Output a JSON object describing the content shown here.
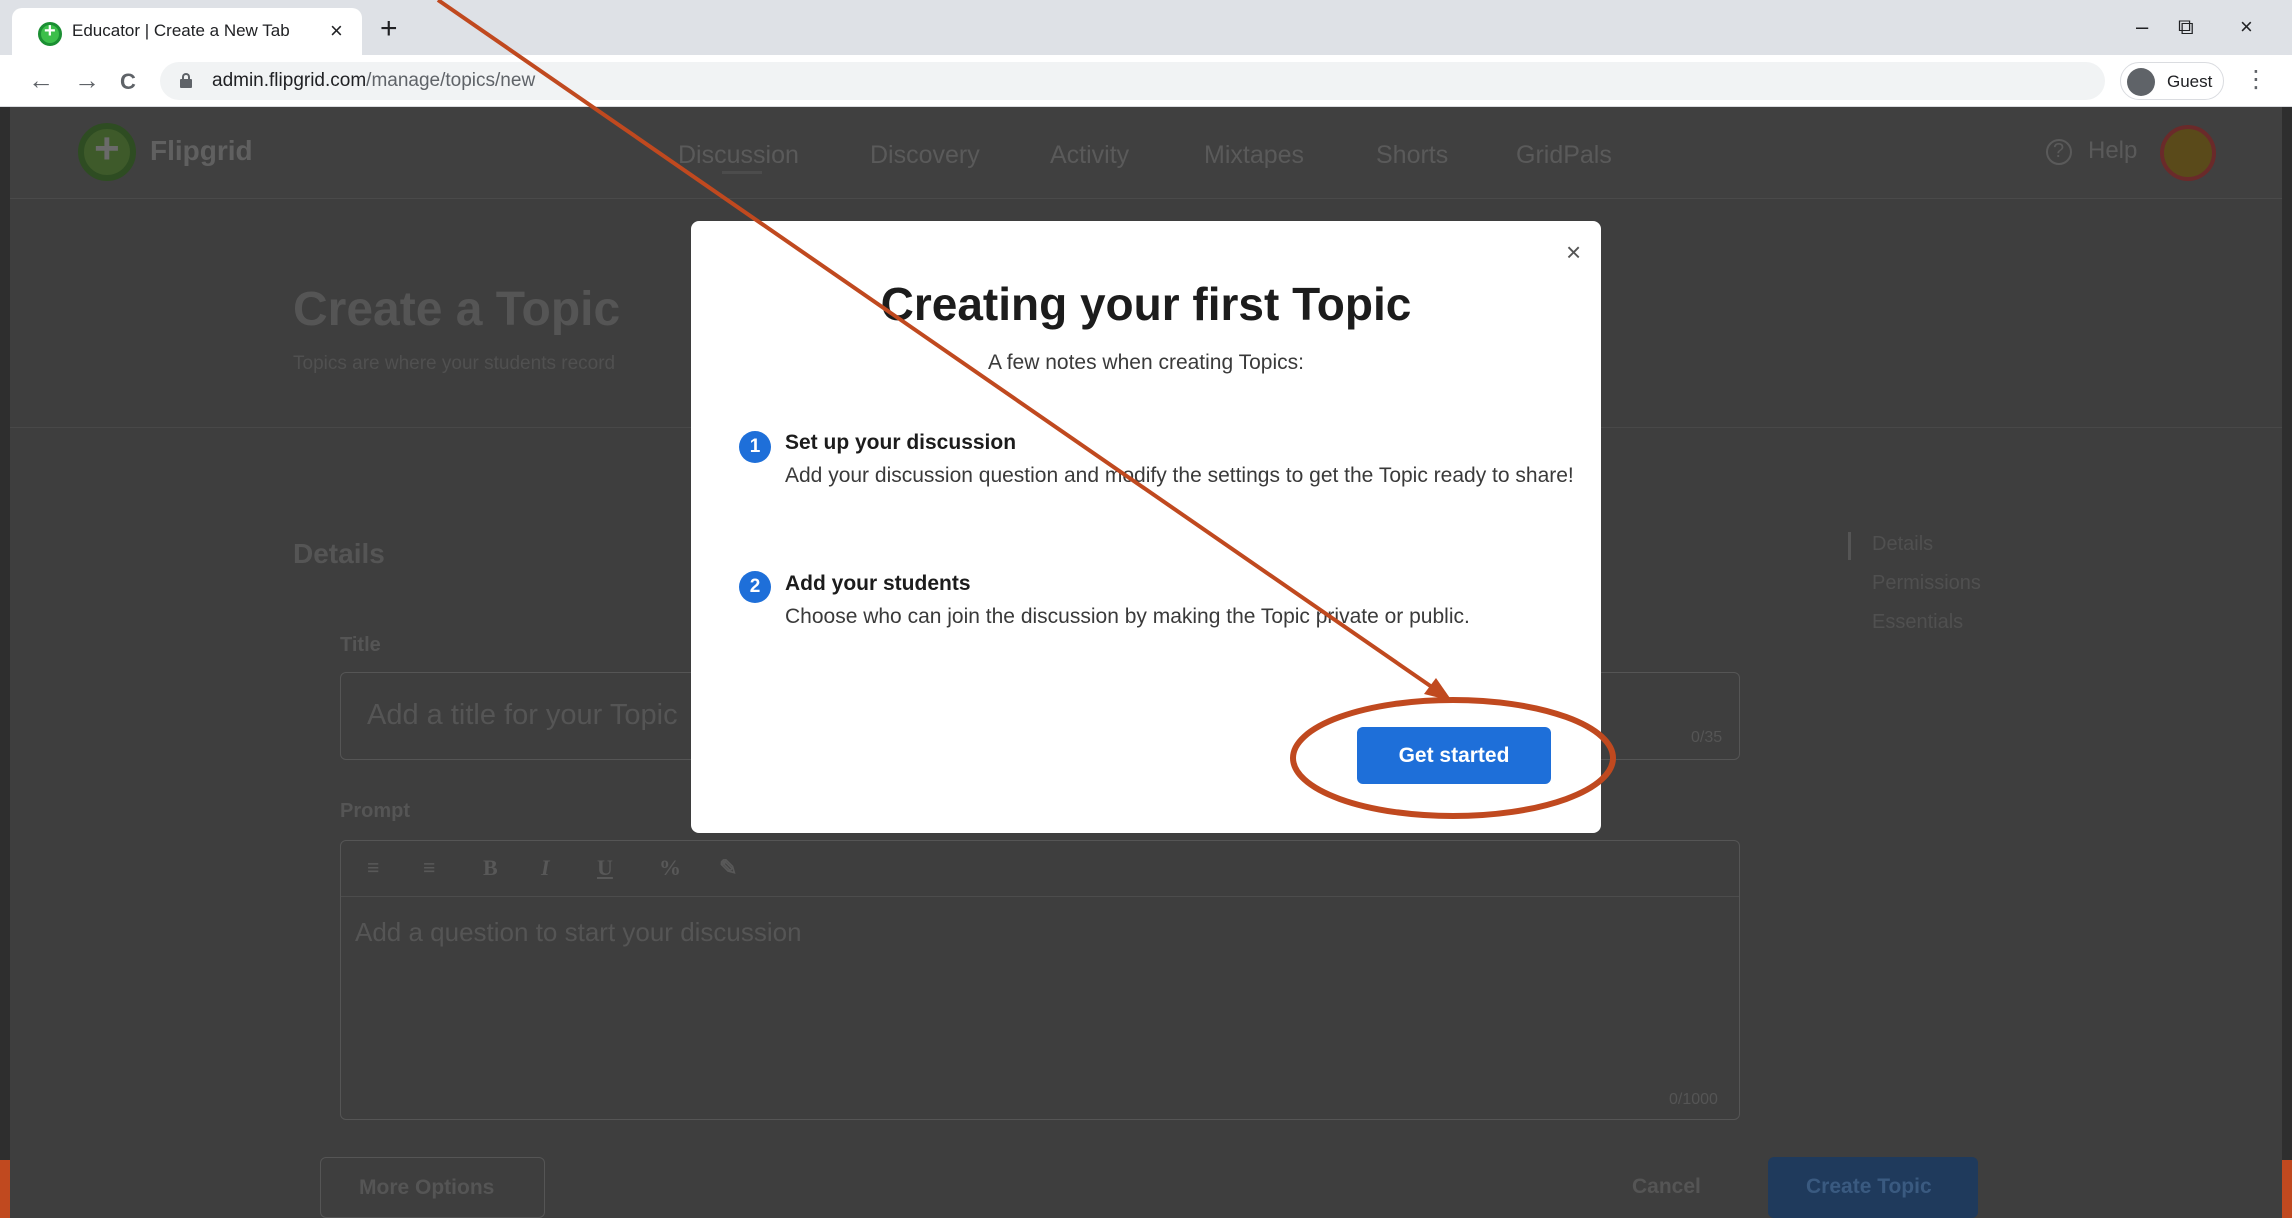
{
  "browser": {
    "tab_title": "Educator | Create a New Tab",
    "tab_close": "×",
    "new_tab": "+",
    "url_host": "admin.flipgrid.com",
    "url_path": "/manage/topics/new",
    "profile_label": "Guest",
    "window_controls": {
      "minimize": "–",
      "restore": "⧉",
      "close": "×"
    },
    "nav": {
      "back": "←",
      "forward": "→",
      "reload": "C",
      "menu": "⋮"
    }
  },
  "app": {
    "logo_text": "Flipgrid",
    "nav_items": [
      "Discussion",
      "Discovery",
      "Activity",
      "Mixtapes",
      "Shorts",
      "GridPals"
    ],
    "active_nav": "Discussion",
    "help_label": "Help",
    "help_icon_glyph": "?",
    "page_title": "Create a Topic",
    "page_subtitle": "Topics are where your students record",
    "details_heading": "Details",
    "side_links": [
      "Details",
      "Permissions",
      "Essentials"
    ],
    "title_label": "Title",
    "title_placeholder": "Add a title for your Topic",
    "title_counter": "0/35",
    "prompt_label": "Prompt",
    "prompt_toolbar": [
      "≡",
      "≡",
      "B",
      "I",
      "U",
      "%",
      "✎"
    ],
    "prompt_placeholder": "Add a question to start your discussion",
    "prompt_counter": "0/1000",
    "more_options": "More Options",
    "cancel": "Cancel",
    "create_topic": "Create Topic"
  },
  "modal": {
    "close": "×",
    "title": "Creating your first Topic",
    "subtitle": "A few notes when creating Topics:",
    "steps": [
      {
        "number": "1",
        "title": "Set up your discussion",
        "text": "Add your discussion question and modify the settings to get the Topic ready to share!"
      },
      {
        "number": "2",
        "title": "Add your students",
        "text": "Choose who can join the discussion by making the Topic private or public."
      }
    ],
    "cta": "Get started"
  },
  "colors": {
    "accent_blue": "#1e6fd9",
    "annotation_orange": "#c0491f"
  }
}
